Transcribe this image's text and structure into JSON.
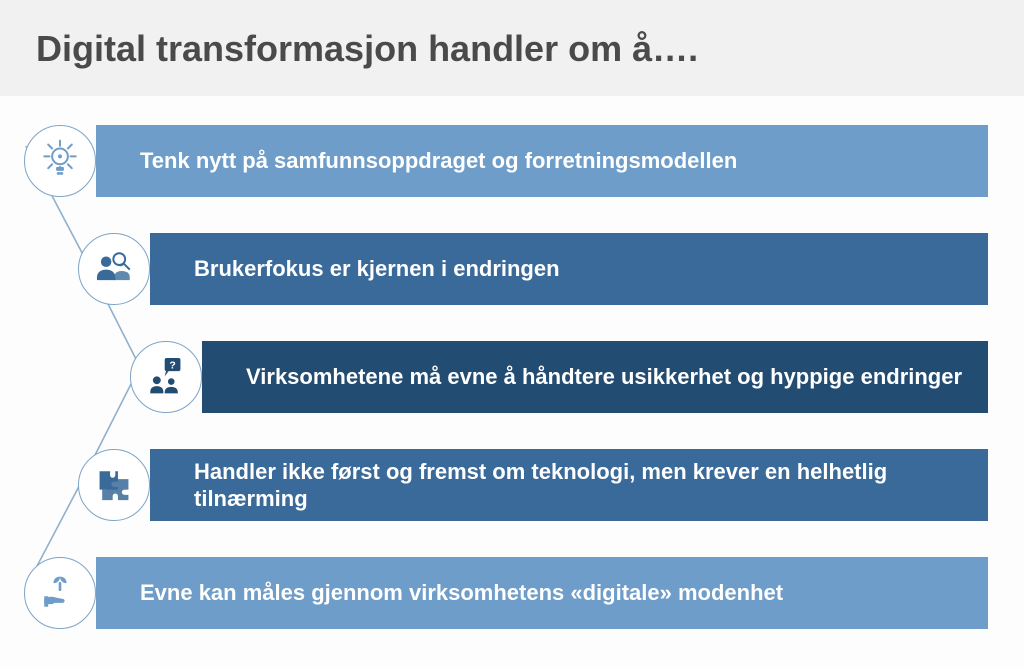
{
  "title": "Digital transformasjon handler om å….",
  "items": [
    {
      "icon": "lightbulb-icon",
      "text": "Tenk nytt på samfunnsoppdraget og forretningsmodellen",
      "color": "#6f9dc9",
      "iconColor": "#6f9dc9"
    },
    {
      "icon": "users-search-icon",
      "text": "Brukerfokus er kjernen i endringen",
      "color": "#3a6a99",
      "iconColor": "#3a6a99"
    },
    {
      "icon": "question-people-icon",
      "text": "Virksomhetene må evne å håndtere usikkerhet og hyppige endringer",
      "color": "#234c72",
      "iconColor": "#234c72"
    },
    {
      "icon": "puzzle-icon",
      "text": "Handler ikke først og fremst om teknologi, men krever en helhetlig tilnærming",
      "color": "#3a6a99",
      "iconColor": "#3a6a99"
    },
    {
      "icon": "growth-hand-icon",
      "text": "Evne kan måles gjennom virksomhetens «digitale» modenhet",
      "color": "#6f9dc9",
      "iconColor": "#6f9dc9"
    }
  ]
}
